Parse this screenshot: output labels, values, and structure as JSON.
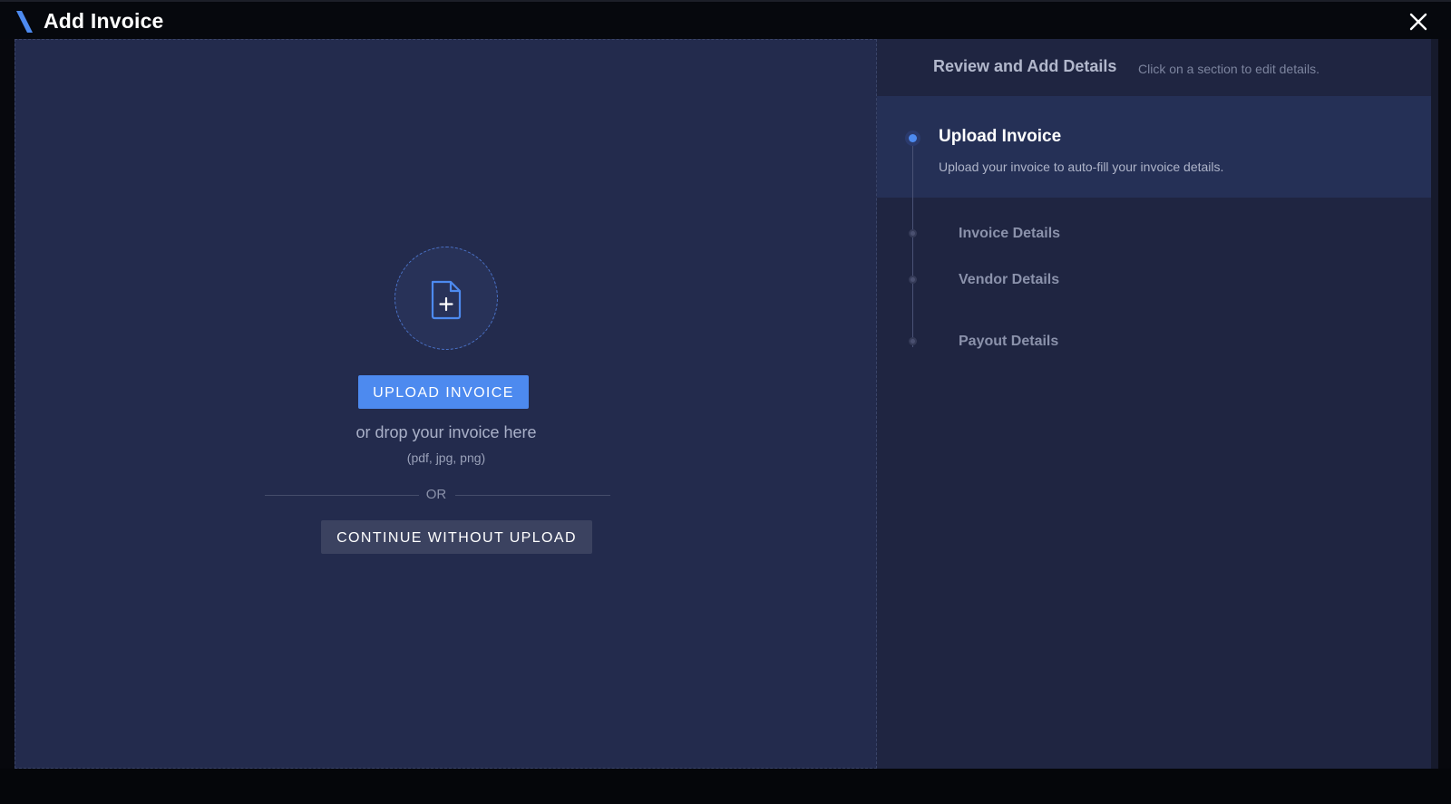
{
  "header": {
    "title": "Add Invoice",
    "logo_icon": "app-logo-slash",
    "close_icon": "close-icon"
  },
  "upload": {
    "icon": "file-plus-icon",
    "button_label": "UPLOAD INVOICE",
    "drop_text": "or drop your invoice here",
    "file_types": "(pdf, jpg, png)",
    "or_label": "OR",
    "continue_label": "CONTINUE WITHOUT UPLOAD"
  },
  "review": {
    "title": "Review and Add Details",
    "subtitle": "Click on a section to edit details.",
    "active_step": {
      "title": "Upload Invoice",
      "description": "Upload your invoice to auto-fill your invoice details."
    },
    "steps": [
      {
        "label": "Invoice Details"
      },
      {
        "label": "Vendor Details"
      },
      {
        "label": "Payout Details"
      }
    ]
  },
  "colors": {
    "accent": "#4d8aef",
    "left_panel": "#232b4d",
    "right_panel": "#1f2541",
    "active_step_bg": "#253056"
  }
}
